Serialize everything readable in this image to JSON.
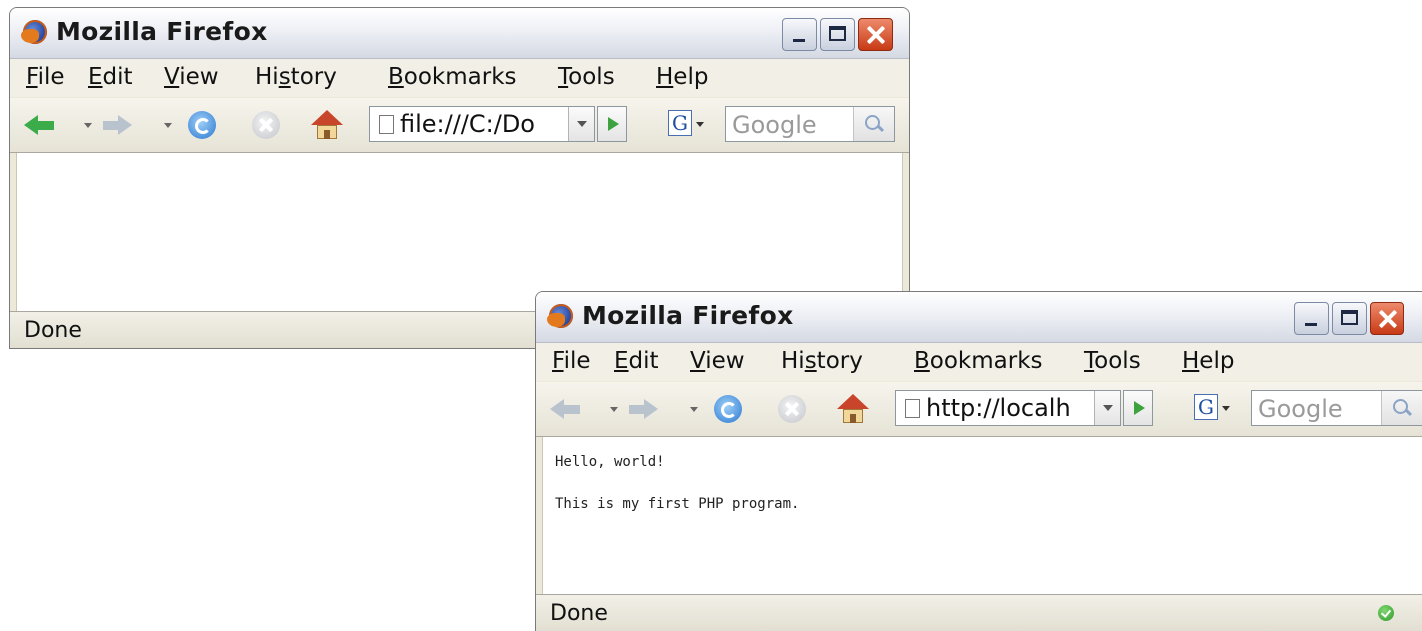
{
  "windows": [
    {
      "title": "Mozilla Firefox",
      "menu": [
        {
          "label": "File",
          "mnemonic": "F",
          "rest": "ile"
        },
        {
          "label": "Edit",
          "mnemonic": "E",
          "rest": "dit"
        },
        {
          "label": "View",
          "mnemonic": "V",
          "rest": "iew"
        },
        {
          "label": "History",
          "pre": "Hi",
          "mnemonic": "s",
          "rest": "tory"
        },
        {
          "label": "Bookmarks",
          "mnemonic": "B",
          "rest": "ookmarks"
        },
        {
          "label": "Tools",
          "mnemonic": "T",
          "rest": "ools"
        },
        {
          "label": "Help",
          "mnemonic": "H",
          "rest": "elp"
        }
      ],
      "address": "file:///C:/Do",
      "search_placeholder": "Google",
      "search_engine_letter": "G",
      "content_lines": [],
      "status": "Done",
      "back_enabled": true
    },
    {
      "title": "Mozilla Firefox",
      "menu": [
        {
          "label": "File",
          "mnemonic": "F",
          "rest": "ile"
        },
        {
          "label": "Edit",
          "mnemonic": "E",
          "rest": "dit"
        },
        {
          "label": "View",
          "mnemonic": "V",
          "rest": "iew"
        },
        {
          "label": "History",
          "pre": "Hi",
          "mnemonic": "s",
          "rest": "tory"
        },
        {
          "label": "Bookmarks",
          "mnemonic": "B",
          "rest": "ookmarks"
        },
        {
          "label": "Tools",
          "mnemonic": "T",
          "rest": "ools"
        },
        {
          "label": "Help",
          "mnemonic": "H",
          "rest": "elp"
        }
      ],
      "address": "http://localh",
      "search_placeholder": "Google",
      "search_engine_letter": "G",
      "content_lines": [
        "Hello, world!",
        "This is my first PHP program."
      ],
      "status": "Done",
      "back_enabled": false
    }
  ],
  "colors": {
    "back_enabled": "#3cab4a",
    "nav_disabled": "#b9c3ce",
    "go_green": "#3ea33f",
    "close_red": "#c83a15"
  },
  "icons": [
    "firefox-icon",
    "minimize-icon",
    "maximize-icon",
    "close-icon",
    "back-icon",
    "forward-icon",
    "reload-icon",
    "stop-icon",
    "home-icon",
    "page-icon",
    "go-icon",
    "google-icon",
    "search-icon",
    "secure-status-icon"
  ]
}
